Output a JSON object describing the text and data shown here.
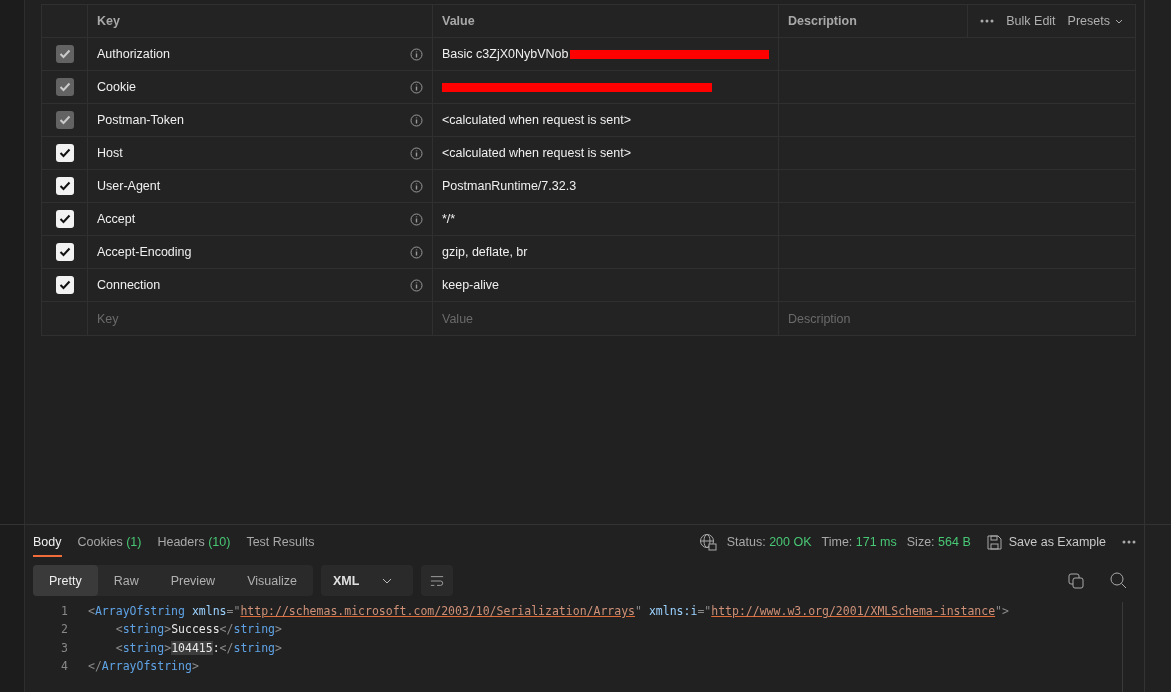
{
  "headers_table": {
    "columns": [
      {
        "label": "Key"
      },
      {
        "label": "Value"
      },
      {
        "label": "Description"
      }
    ],
    "actions": {
      "bulk_edit": "Bulk Edit",
      "presets": "Presets"
    },
    "rows": [
      {
        "checked": true,
        "disabled": true,
        "key": "Authorization",
        "value": "Basic c3ZjX0NybVNob",
        "redacted": true
      },
      {
        "checked": true,
        "disabled": true,
        "key": "Cookie",
        "redacted": true
      },
      {
        "checked": true,
        "disabled": true,
        "key": "Postman-Token",
        "value": "<calculated when request is sent>"
      },
      {
        "checked": true,
        "disabled": false,
        "key": "Host",
        "value": "<calculated when request is sent>"
      },
      {
        "checked": true,
        "disabled": false,
        "key": "User-Agent",
        "value": "PostmanRuntime/7.32.3"
      },
      {
        "checked": true,
        "disabled": false,
        "key": "Accept",
        "value": "*/*"
      },
      {
        "checked": true,
        "disabled": false,
        "key": "Accept-Encoding",
        "value": "gzip, deflate, br"
      },
      {
        "checked": true,
        "disabled": false,
        "key": "Connection",
        "value": "keep-alive"
      }
    ],
    "new_row": {
      "key_placeholder": "Key",
      "value_placeholder": "Value",
      "description_placeholder": "Description"
    }
  },
  "response": {
    "tabs": [
      {
        "label": "Body",
        "selected": true
      },
      {
        "label": "Cookies",
        "count": "(1)",
        "selected": false
      },
      {
        "label": "Headers",
        "count": "(10)",
        "selected": false
      },
      {
        "label": "Test Results",
        "selected": false
      }
    ],
    "meta": [
      {
        "label": "Status:",
        "value": "200 OK"
      },
      {
        "label": "Time:",
        "value": "171 ms"
      },
      {
        "label": "Size:",
        "value": "564 B"
      }
    ],
    "save_as_example": "Save as Example",
    "view_modes": [
      {
        "label": "Pretty",
        "selected": true
      },
      {
        "label": "Raw",
        "selected": false
      },
      {
        "label": "Preview",
        "selected": false
      },
      {
        "label": "Visualize",
        "selected": false
      }
    ],
    "format": "XML",
    "code": [
      {
        "number": "1",
        "tokens": [
          {
            "kind": "punct",
            "text": "<"
          },
          {
            "kind": "tag",
            "text": "ArrayOfstring"
          },
          {
            "kind": "space"
          },
          {
            "kind": "attr",
            "text": "xmlns"
          },
          {
            "kind": "punct",
            "text": "=\""
          },
          {
            "kind": "url",
            "text": "http://schemas.microsoft.com/2003/10/Serialization/Arrays"
          },
          {
            "kind": "punct",
            "text": "\""
          },
          {
            "kind": "space"
          },
          {
            "kind": "attr",
            "text": "xmlns:i"
          },
          {
            "kind": "punct",
            "text": "=\""
          },
          {
            "kind": "url",
            "text": "http://www.w3.org/2001/XMLSchema-instance"
          },
          {
            "kind": "punct",
            "text": "\">"
          }
        ]
      },
      {
        "number": "2",
        "tokens": [
          {
            "kind": "indent"
          },
          {
            "kind": "punct",
            "text": "<"
          },
          {
            "kind": "tag",
            "text": "string"
          },
          {
            "kind": "punct",
            "text": ">"
          },
          {
            "kind": "text",
            "text": "Success"
          },
          {
            "kind": "punct",
            "text": "</"
          },
          {
            "kind": "tag",
            "text": "string"
          },
          {
            "kind": "punct",
            "text": ">"
          }
        ]
      },
      {
        "number": "3",
        "tokens": [
          {
            "kind": "indent"
          },
          {
            "kind": "punct",
            "text": "<"
          },
          {
            "kind": "tag",
            "text": "string"
          },
          {
            "kind": "punct",
            "text": ">"
          },
          {
            "kind": "highlight",
            "text": "104415"
          },
          {
            "kind": "text",
            "text": ":"
          },
          {
            "kind": "punct",
            "text": "</"
          },
          {
            "kind": "tag",
            "text": "string"
          },
          {
            "kind": "punct",
            "text": ">"
          }
        ]
      },
      {
        "number": "4",
        "tokens": [
          {
            "kind": "punct",
            "text": "</"
          },
          {
            "kind": "tag",
            "text": "ArrayOfstring"
          },
          {
            "kind": "punct",
            "text": ">"
          }
        ]
      }
    ]
  }
}
